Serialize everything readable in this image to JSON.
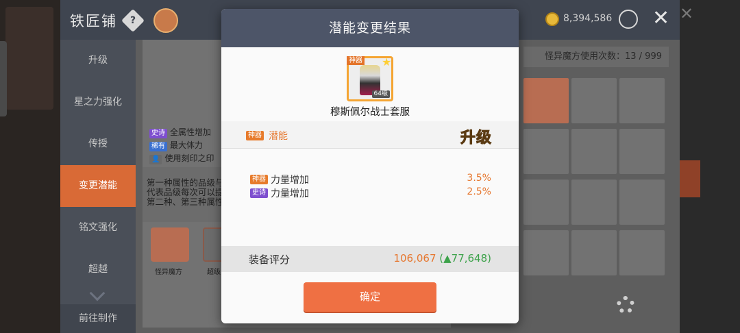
{
  "smith": {
    "title": "铁匠铺",
    "help_icon": "?",
    "meso": "8,394,586",
    "close": "✕"
  },
  "sidebar": {
    "items": [
      {
        "label": "升级"
      },
      {
        "label": "星之力强化"
      },
      {
        "label": "传授"
      },
      {
        "label": "变更潜能"
      },
      {
        "label": "铭文强化"
      },
      {
        "label": "超越"
      }
    ],
    "active_index": 3,
    "goto_label": "前往制作"
  },
  "content": {
    "cube_counter": "怪异魔方使用次数：13 / 999",
    "potential_lines": [
      {
        "tag": "史诗",
        "text": "全属性增加"
      },
      {
        "tag": "稀有",
        "text": "最大体力"
      },
      {
        "tag": "",
        "text": "使用刻印之印"
      }
    ],
    "description": [
      "第一种属性的品级与",
      "代表品级每次可以提",
      "第二种、第三种属性"
    ],
    "items": [
      {
        "label": "怪异魔方"
      },
      {
        "label": "超级"
      }
    ]
  },
  "modal": {
    "title": "潜能变更结果",
    "item": {
      "badge": "神器",
      "level": "64级",
      "name": "穆斯佩尔战士套服"
    },
    "potential": {
      "tag": "神器",
      "label": "潜能",
      "upgrade": "升级"
    },
    "stats": [
      {
        "tag": "神器",
        "tag_class": "legend",
        "name": "力量增加",
        "value": "3.5%"
      },
      {
        "tag": "史诗",
        "tag_class": "epic",
        "name": "力量增加",
        "value": "2.5%"
      }
    ],
    "score": {
      "label": "装备评分",
      "value": "106,067",
      "delta": "(▲77,648)"
    },
    "confirm_label": "确定"
  },
  "colors": {
    "accent": "#ef7043",
    "header": "#4d5568",
    "legend": "#e77b2c",
    "epic": "#7e4fcf",
    "positive": "#3ca24a"
  }
}
